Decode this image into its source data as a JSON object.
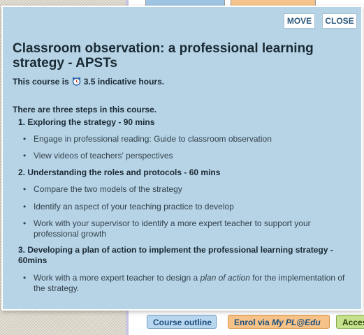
{
  "background": {
    "buttons": [
      {
        "label": "Course outline"
      },
      {
        "label_prefix": "Enrol via ",
        "label_italic": "My PL@Edu"
      },
      {
        "label": "Acces"
      }
    ]
  },
  "modal": {
    "move_label": "MOVE",
    "close_label": "CLOSE",
    "title": "Classroom observation: a professional learning strategy - APSTs",
    "hours_prefix": "This course is",
    "hours_value": "3.5 indicative hours.",
    "steps_intro": "There are three steps in this course.",
    "steps": [
      {
        "number": "1.",
        "title": "Exploring the strategy - 90 mins",
        "items": [
          "Engage in professional reading: Guide to classroom observation",
          "View videos of teachers' perspectives"
        ]
      },
      {
        "number": "2.",
        "title": "Understanding the roles and protocols - 60 mins",
        "items": [
          "Compare the two models of the strategy",
          "Identify an aspect of your teaching practice to develop",
          "Work with your supervisor to identify a more expert teacher to support your professional growth"
        ]
      },
      {
        "number": "3.",
        "title": "Developing a plan of action to implement the professional learning strategy - 60mins",
        "items_rich": {
          "before": "Work with a more expert teacher to design a ",
          "italic": "plan of action",
          "after": " for the implementation of the strategy."
        }
      }
    ]
  },
  "colors": {
    "modal_bg": "#b7d3e6",
    "title_text": "#1a2a33",
    "button_text": "#2c5a7e"
  }
}
